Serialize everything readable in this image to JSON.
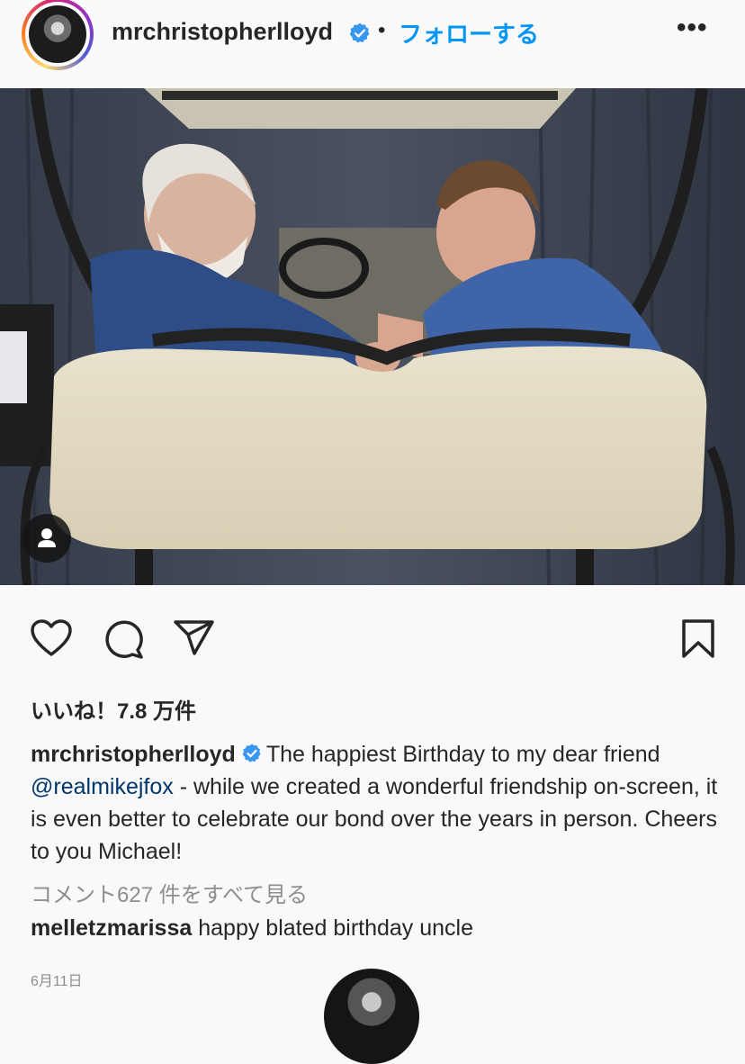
{
  "post_header": {
    "username": "mrchristopherlloyd",
    "separator": "•",
    "follow_label": "フォローする",
    "more_label": "•••",
    "verified_color": "#3897f0"
  },
  "actions": {
    "like_icon": "heart-icon",
    "comment_icon": "comment-bubble-icon",
    "share_icon": "paper-plane-icon",
    "save_icon": "bookmark-icon"
  },
  "likes": {
    "label": "いいね！7.8 万件"
  },
  "caption": {
    "username": "mrchristopherlloyd",
    "text_before_mention": "The happiest Birthday to my dear friend ",
    "mention": "@realmikejfox",
    "text_after_mention": " - while we created a wonderful friendship on-screen, it is even better to celebrate our bond over the years in person. Cheers to you Michael!"
  },
  "view_comments_label": "コメント627 件をすべて見る",
  "comment": {
    "username": "melletzmarissa",
    "text": "happy blated birthday uncle"
  },
  "date": "6月11日"
}
